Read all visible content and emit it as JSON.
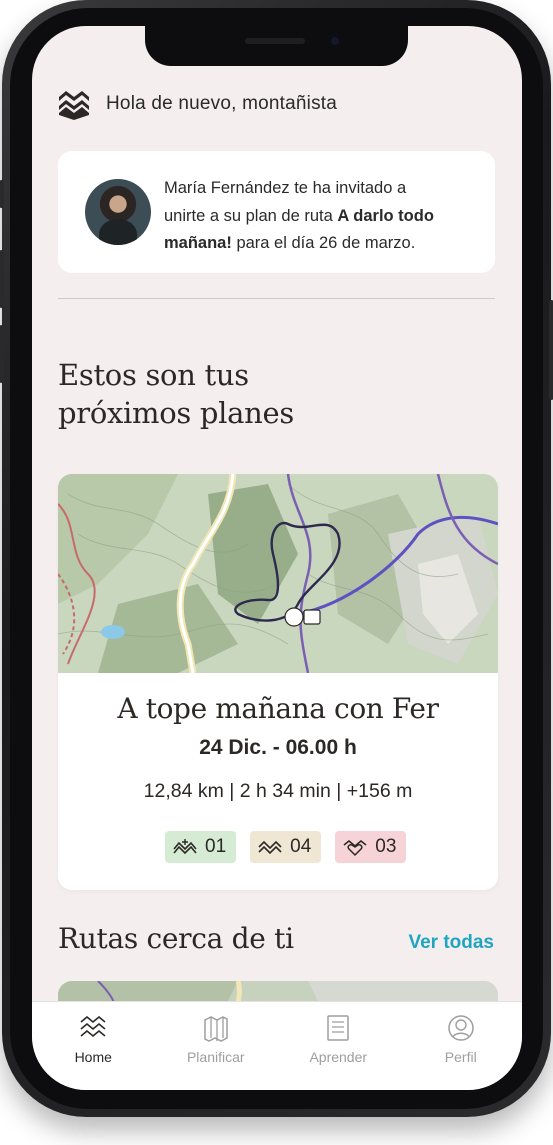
{
  "header": {
    "greeting": "Hola de nuevo, montañista",
    "logo_icon": "waves-logo-icon"
  },
  "invite": {
    "name_line": "María Fernández te ha invitado a",
    "line2_prefix": "unirte a su plan de ruta ",
    "plan_name_part1": "A darlo todo",
    "plan_name_part2": "mañana!",
    "line3_suffix": " para el día 26 de marzo."
  },
  "upcoming": {
    "title_line1": "Estos son tus",
    "title_line2": "próximos planes"
  },
  "plan": {
    "title": "A tope mañana con Fer",
    "date": "24 Dic. - 06.00 h",
    "stats": "12,84 km | 2 h 34 min | +156 m",
    "badges": [
      {
        "icon": "terrain-level-icon",
        "value": "01",
        "color": "#d6ebd3"
      },
      {
        "icon": "effort-level-icon",
        "value": "04",
        "color": "#efe6d3"
      },
      {
        "icon": "heart-level-icon",
        "value": "03",
        "color": "#f6d3d6"
      }
    ]
  },
  "nearby": {
    "title": "Rutas cerca de ti",
    "see_all": "Ver todas"
  },
  "tabs": [
    {
      "label": "Home",
      "icon": "waves-icon",
      "active": true
    },
    {
      "label": "Planificar",
      "icon": "map-icon",
      "active": false
    },
    {
      "label": "Aprender",
      "icon": "book-icon",
      "active": false
    },
    {
      "label": "Perfil",
      "icon": "profile-icon",
      "active": false
    }
  ],
  "colors": {
    "background": "#f4efee",
    "accent": "#1fa5c2",
    "text": "#2b2826",
    "route_purple": "#6a3fb0"
  }
}
